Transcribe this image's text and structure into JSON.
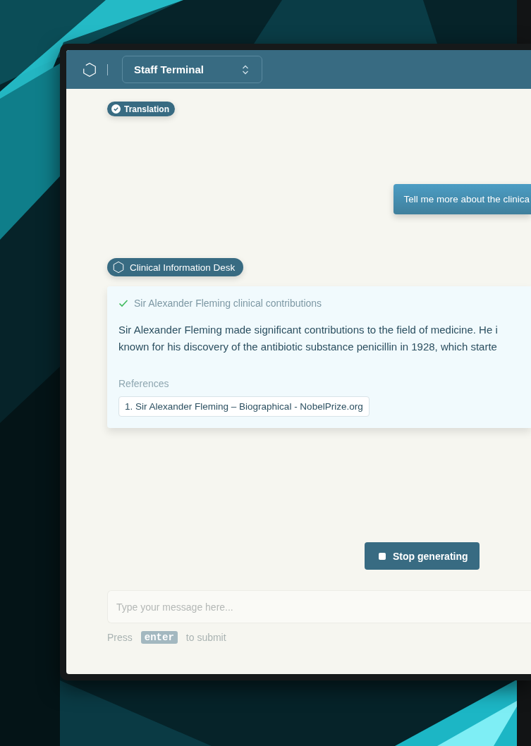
{
  "header": {
    "workspace": "Staff Terminal"
  },
  "mode_badge": {
    "label": "Translation",
    "active": true
  },
  "messages": [
    {
      "kind": "user",
      "text": "Tell me more about the clinica"
    },
    {
      "kind": "agent",
      "agent": "Clinical Information Desk",
      "step": {
        "label": "Sir Alexander Fleming clinical contributions",
        "done": true
      },
      "lines": [
        "Sir Alexander Fleming made significant contributions to the field of medicine. He i",
        "known for his discovery of the antibiotic substance penicillin in 1928, which starte"
      ],
      "references_title": "References",
      "references": [
        "1. Sir Alexander Fleming – Biographical - NobelPrize.org"
      ]
    }
  ],
  "stop_button": "Stop generating",
  "composer": {
    "placeholder": "Type your message here...",
    "hint_before": "Press",
    "key": "enter",
    "hint_after": "to submit"
  }
}
